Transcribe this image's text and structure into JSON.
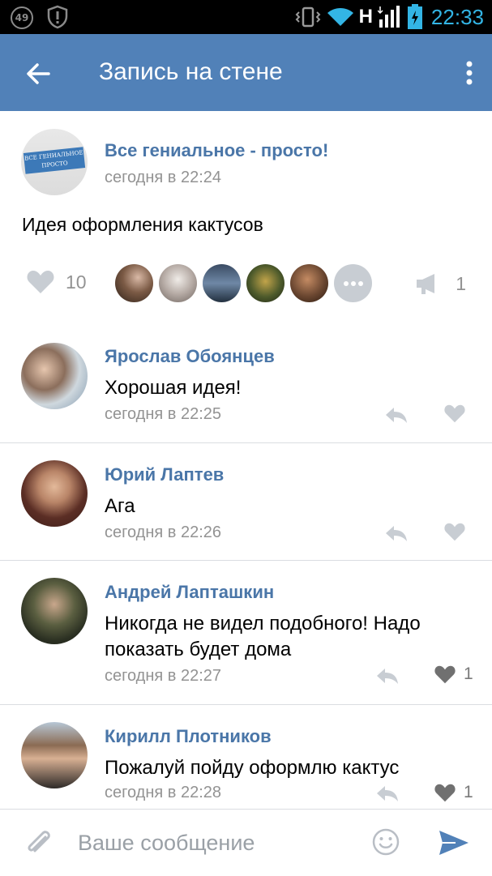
{
  "status_bar": {
    "notification_count": "49",
    "network_type": "H",
    "time": "22:33",
    "icons": [
      "badge-icon",
      "shield-alert-icon",
      "vibrate-icon",
      "wifi-icon",
      "signal-icon",
      "battery-charging-icon"
    ]
  },
  "app_bar": {
    "title": "Запись на стене",
    "back_icon": "arrow-left-icon",
    "menu_icon": "more-vertical-icon"
  },
  "post": {
    "author": "Все гениальное - просто!",
    "avatar_text": "ВСЕ ГЕНИАЛЬНОЕ ПРОСТО",
    "time": "сегодня в 22:24",
    "text": "Идея оформления кактусов",
    "likes_count": "10",
    "shares_count": "1"
  },
  "comments": [
    {
      "author": "Ярослав Обоянцев",
      "text": "Хорошая идея!",
      "time": "сегодня в 22:25",
      "likes": ""
    },
    {
      "author": "Юрий Лаптев",
      "text": "Ага",
      "time": "сегодня в 22:26",
      "likes": ""
    },
    {
      "author": "Андрей Лапташкин",
      "text": "Никогда не видел подобного! Надо показать будет дома",
      "time": "сегодня в 22:27",
      "likes": "1"
    },
    {
      "author": "Кирилл Плотников",
      "text": "Пожалуй пойду оформлю кактус",
      "time": "сегодня в 22:28",
      "likes": "1"
    }
  ],
  "input_bar": {
    "placeholder": "Ваше сообщение"
  },
  "colors": {
    "header": "#5181b8",
    "link": "#4a76a8",
    "muted": "#939393",
    "icon_gray": "#c8cdd3"
  }
}
